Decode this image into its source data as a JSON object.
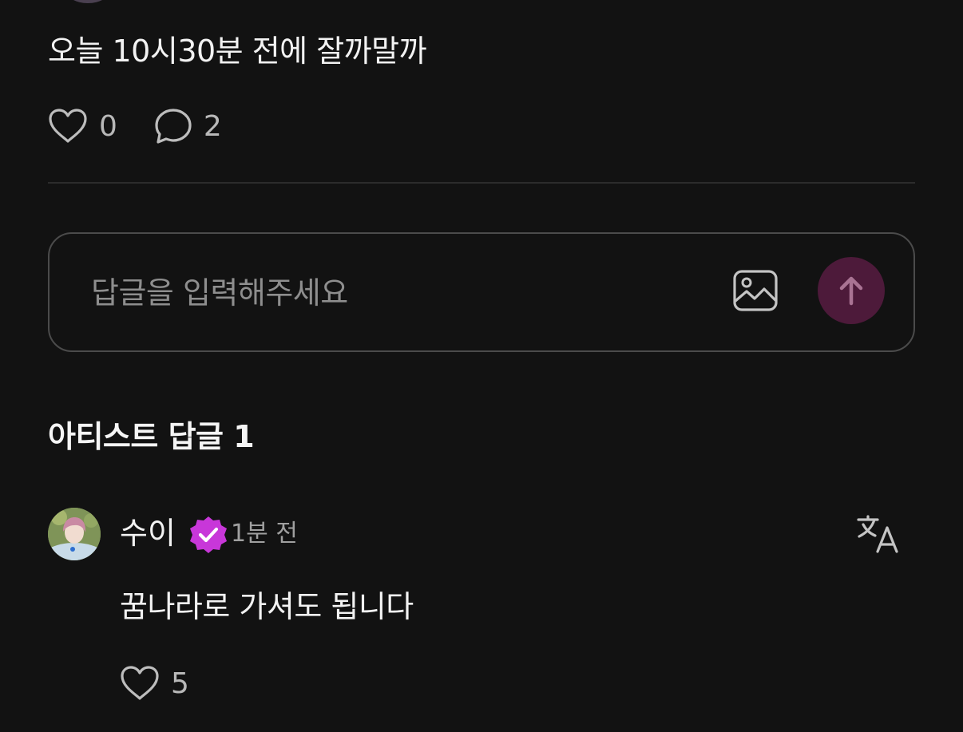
{
  "post": {
    "text": "오늘 10시30분 전에 잘까말까",
    "like_count": "0",
    "comment_count": "2"
  },
  "reply_input": {
    "placeholder": "답글을 입력해주세요",
    "image_icon": "image-icon",
    "send_icon": "arrow-up-icon"
  },
  "artist_replies": {
    "title": "아티스트 답글 1",
    "comments": [
      {
        "author": "수이",
        "badge_icon": "verified-badge-icon",
        "time": "1분 전",
        "text": "꿈나라로 가셔도 됩니다",
        "like_count": "5",
        "translate_icon": "translate-icon"
      }
    ]
  },
  "colors": {
    "background": "#121212",
    "send_button": "#4d1a3a",
    "badge": "#c837d9",
    "divider": "#2c2c2c",
    "input_border": "#4b4b4b"
  }
}
